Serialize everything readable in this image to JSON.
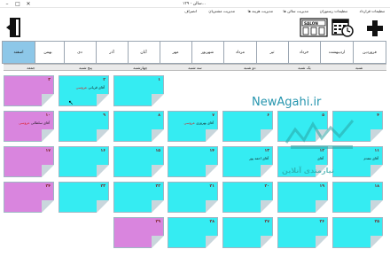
{
  "window": {
    "title": "سالن - ۱۳۹..."
  },
  "menu": {
    "items": [
      {
        "label": "تنظیمات قرارداد"
      },
      {
        "label": "تنظیمات رستوران"
      },
      {
        "label": "مدیریت سالن ها"
      },
      {
        "label": "مدیریت هزینه ها"
      },
      {
        "label": "مدیریت مشتریان"
      },
      {
        "label": "انصراف"
      }
    ]
  },
  "toolbar": {
    "salon_label": "SALON"
  },
  "months": [
    {
      "label": "فروردین",
      "active": false
    },
    {
      "label": "اردیبهشت",
      "active": false
    },
    {
      "label": "خرداد",
      "active": false
    },
    {
      "label": "تیر",
      "active": false
    },
    {
      "label": "مرداد",
      "active": false
    },
    {
      "label": "شهریور",
      "active": false
    },
    {
      "label": "مهر",
      "active": false
    },
    {
      "label": "آبان",
      "active": false
    },
    {
      "label": "آذر",
      "active": false
    },
    {
      "label": "دی",
      "active": false
    },
    {
      "label": "بهمن",
      "active": false
    },
    {
      "label": "اسفند",
      "active": true
    }
  ],
  "weekdays": [
    "شنبه",
    "یک شنبه",
    "دو شنبه",
    "سه شنبه",
    "چهارشنبه",
    "پنج شنبه",
    "جمعه"
  ],
  "days": [
    {
      "num": "۱",
      "tag_red": "",
      "tag": "",
      "bottom": ""
    },
    {
      "num": "۲",
      "tag_red": "عروسی",
      "tag": "آقای قربانی",
      "bottom": ""
    },
    {
      "num": "۳",
      "tag_red": "",
      "tag": "",
      "bottom": ""
    },
    {
      "num": "۴",
      "tag_red": "",
      "tag": "",
      "bottom": ""
    },
    {
      "num": "۵",
      "tag_red": "",
      "tag": "",
      "bottom": ""
    },
    {
      "num": "۶",
      "tag_red": "",
      "tag": "",
      "bottom": ""
    },
    {
      "num": "۷",
      "tag_red": "عروسی",
      "tag": "آقای بهروزی",
      "bottom": ""
    },
    {
      "num": "۸",
      "tag_red": "",
      "tag": "",
      "bottom": ""
    },
    {
      "num": "۹",
      "tag_red": "",
      "tag": "",
      "bottom": ""
    },
    {
      "num": "۱۰",
      "tag_red": "عروسی",
      "tag": "آقای سلطانی",
      "bottom": ""
    },
    {
      "num": "۱۱",
      "tag_red": "",
      "tag": "آقای مقدم",
      "bottom": ""
    },
    {
      "num": "۱۲",
      "tag_red": "",
      "tag": "آقای",
      "bottom": ""
    },
    {
      "num": "۱۳",
      "tag_red": "",
      "tag": "آقای احمد پور",
      "bottom": ""
    },
    {
      "num": "۱۴",
      "tag_red": "",
      "tag": "",
      "bottom": ""
    },
    {
      "num": "۱۵",
      "tag_red": "",
      "tag": "",
      "bottom": ""
    },
    {
      "num": "۱۶",
      "tag_red": "",
      "tag": "",
      "bottom": ""
    },
    {
      "num": "۱۷",
      "tag_red": "",
      "tag": "",
      "bottom": ""
    },
    {
      "num": "۱۸",
      "tag_red": "",
      "tag": "",
      "bottom": ""
    },
    {
      "num": "۱۹",
      "tag_red": "",
      "tag": "",
      "bottom": ""
    },
    {
      "num": "۲۰",
      "tag_red": "",
      "tag": "",
      "bottom": ""
    },
    {
      "num": "۲۱",
      "tag_red": "",
      "tag": "",
      "bottom": ""
    },
    {
      "num": "۲۲",
      "tag_red": "",
      "tag": "",
      "bottom": ""
    },
    {
      "num": "۲۳",
      "tag_red": "",
      "tag": "",
      "bottom": ""
    },
    {
      "num": "۲۴",
      "tag_red": "",
      "tag": "",
      "bottom": ""
    },
    {
      "num": "۲۵",
      "tag_red": "",
      "tag": "",
      "bottom": ""
    },
    {
      "num": "۲۶",
      "tag_red": "",
      "tag": "",
      "bottom": ""
    },
    {
      "num": "۲۷",
      "tag_red": "",
      "tag": "",
      "bottom": ""
    },
    {
      "num": "۲۸",
      "tag_red": "",
      "tag": "",
      "bottom": ""
    },
    {
      "num": "۲۹",
      "tag_red": "",
      "tag": "",
      "bottom": ""
    }
  ],
  "watermark": {
    "site": "NewAgahi.ir",
    "line": "نیازمندی آنلاین"
  }
}
